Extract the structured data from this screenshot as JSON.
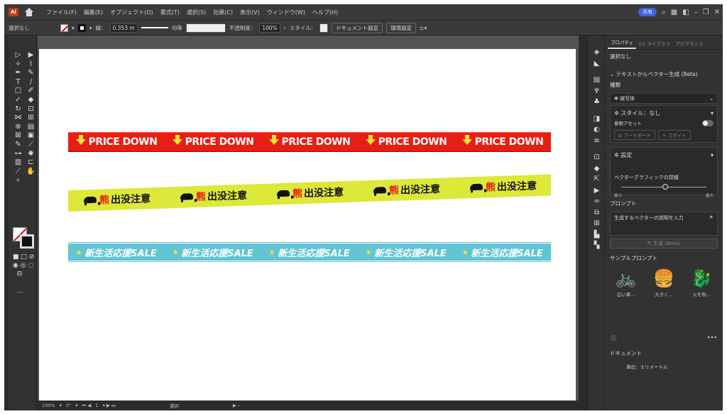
{
  "menu": [
    "ファイル(F)",
    "編集(E)",
    "オブジェクト(O)",
    "書式(T)",
    "選択(S)",
    "効果(C)",
    "表示(V)",
    "ウィンドウ(W)",
    "ヘルプ(H)"
  ],
  "app_icon": "Ai",
  "share": "共有",
  "control": {
    "selection": "選択なし",
    "stroke_label": "線：",
    "stroke_value": "0.353 m",
    "uniform": "均等",
    "opacity_label": "不透明度：",
    "opacity_value": "100%",
    "style_label": "スタイル：",
    "doc_settings": "ドキュメント設定",
    "prefs": "環境設定"
  },
  "banners": {
    "price": {
      "text": "PRICE DOWN",
      "repeat": 5
    },
    "bear": {
      "text_red": "熊",
      "text": "出没注意",
      "repeat": 5
    },
    "sale": {
      "text": "新生活応援SALE",
      "repeat": 5
    }
  },
  "bottom": {
    "zoom": "100%",
    "rotate": "0°",
    "page": "1",
    "mode": "選択"
  },
  "panel": {
    "tabs": [
      "プロパティ",
      "CC ライブラリ",
      "アピアランス"
    ],
    "selection": "選択なし",
    "gen_title": "テキストからベクター生成 (Beta)",
    "type_label": "種類",
    "type_value": "被写体",
    "style_label": "スタイル：なし",
    "ref_asset": "参照アセット",
    "artboard_btn": "アートボード",
    "eyedrop_btn": "スポイト",
    "settings": "設定",
    "detail_label": "ベクターグラフィックの詳細",
    "min": "最小",
    "max": "最大",
    "prompt_label": "プロンプト",
    "prompt_placeholder": "生成するベクターの説明を入力",
    "generate_btn": "生成 (Beta)",
    "sample_title": "サンプルプロンプト",
    "samples": [
      {
        "label": "白い車...",
        "icon": "bicycle-icon"
      },
      {
        "label": "大きく...",
        "icon": "burger-icon"
      },
      {
        "label": "火を吹...",
        "icon": "dragon-icon"
      }
    ],
    "document_label": "ドキュメント",
    "units": "単位：ミリメートル"
  }
}
